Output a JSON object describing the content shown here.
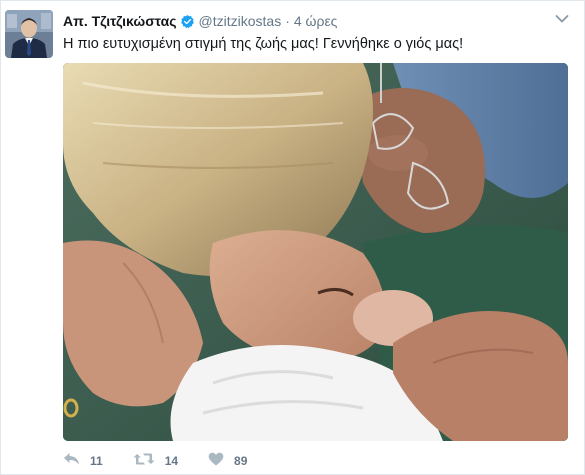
{
  "tweet": {
    "author_name": "Απ. Τζιτζικώστας",
    "author_handle": "@tzitzikostas",
    "separator": "·",
    "timestamp": "4 ώρες",
    "text": "Η πιο ευτυχισμένη στιγμή της ζωής μας! Γεννήθηκε ο γιός μας!",
    "verified": true
  },
  "actions": {
    "reply_count": "11",
    "retweet_count": "14",
    "like_count": "89"
  },
  "icons": {
    "verified": "verified-badge-icon",
    "caret": "chevron-down-icon",
    "reply": "reply-icon",
    "retweet": "retweet-icon",
    "like": "heart-icon"
  },
  "colors": {
    "verified_blue": "#1da1f2",
    "secondary_text": "#657786",
    "action_icon": "#aab8c2"
  }
}
